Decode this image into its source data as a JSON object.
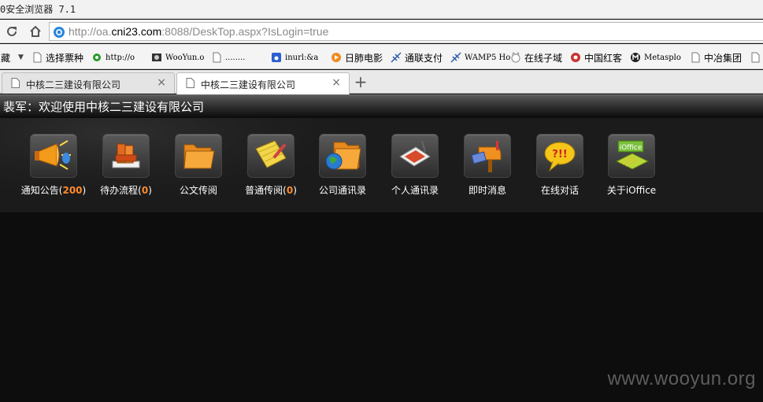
{
  "window": {
    "title": "0安全浏览器 7.1"
  },
  "address": {
    "url_prefix": "http://oa.",
    "url_host": "cni23.com",
    "url_suffix": ":8088/DeskTop.aspx?IsLogin=true"
  },
  "bookmarks": {
    "leading": "藏",
    "items": [
      {
        "label": "选择票种",
        "icon": "page-icon"
      },
      {
        "label": "http://o",
        "icon": "gear-icon"
      },
      {
        "label": "WooYun.o",
        "icon": "wooyun-icon"
      },
      {
        "label": "........",
        "icon": "page-icon"
      },
      {
        "label": "inurl:&a",
        "icon": "paw-icon"
      },
      {
        "label": "日肺电影",
        "icon": "play-icon"
      },
      {
        "label": "通联支付",
        "icon": "signal-icon"
      },
      {
        "label": "WAMP5 Ho",
        "icon": "signal-icon"
      },
      {
        "label": "在线子域",
        "icon": "cat-icon"
      },
      {
        "label": "中国红客",
        "icon": "flower-icon"
      },
      {
        "label": "Metasplo",
        "icon": "metasploit-icon"
      },
      {
        "label": "中冶集团",
        "icon": "page-icon"
      }
    ]
  },
  "tabs": [
    {
      "label": "中核二三建设有限公司",
      "close": "×",
      "active": false
    },
    {
      "label": "中核二三建设有限公司",
      "close": "×",
      "active": true
    }
  ],
  "new_tab": "+",
  "page": {
    "welcome": "裴军：欢迎使用中核二三建设有限公司",
    "tiles": [
      {
        "name": "通知公告",
        "count": "200",
        "icon": "megaphone-icon"
      },
      {
        "name": "待办流程",
        "count": "0",
        "icon": "books-icon"
      },
      {
        "name": "公文传阅",
        "count": "",
        "icon": "folder-icon"
      },
      {
        "name": "普通传阅",
        "count": "0",
        "icon": "notepad-icon"
      },
      {
        "name": "公司通讯录",
        "count": "",
        "icon": "contacts-folder-icon"
      },
      {
        "name": "个人通讯录",
        "count": "",
        "icon": "pda-icon"
      },
      {
        "name": "即时消息",
        "count": "",
        "icon": "mailbox-icon"
      },
      {
        "name": "在线对话",
        "count": "",
        "icon": "chat-bubble-icon"
      },
      {
        "name": "关于iOffice",
        "count": "",
        "icon": "ioffice-chip-icon"
      }
    ],
    "watermark": "www.wooyun.org"
  },
  "colors": {
    "count_accent": "#ff8a2a",
    "page_bg": "#0d0d0d"
  }
}
